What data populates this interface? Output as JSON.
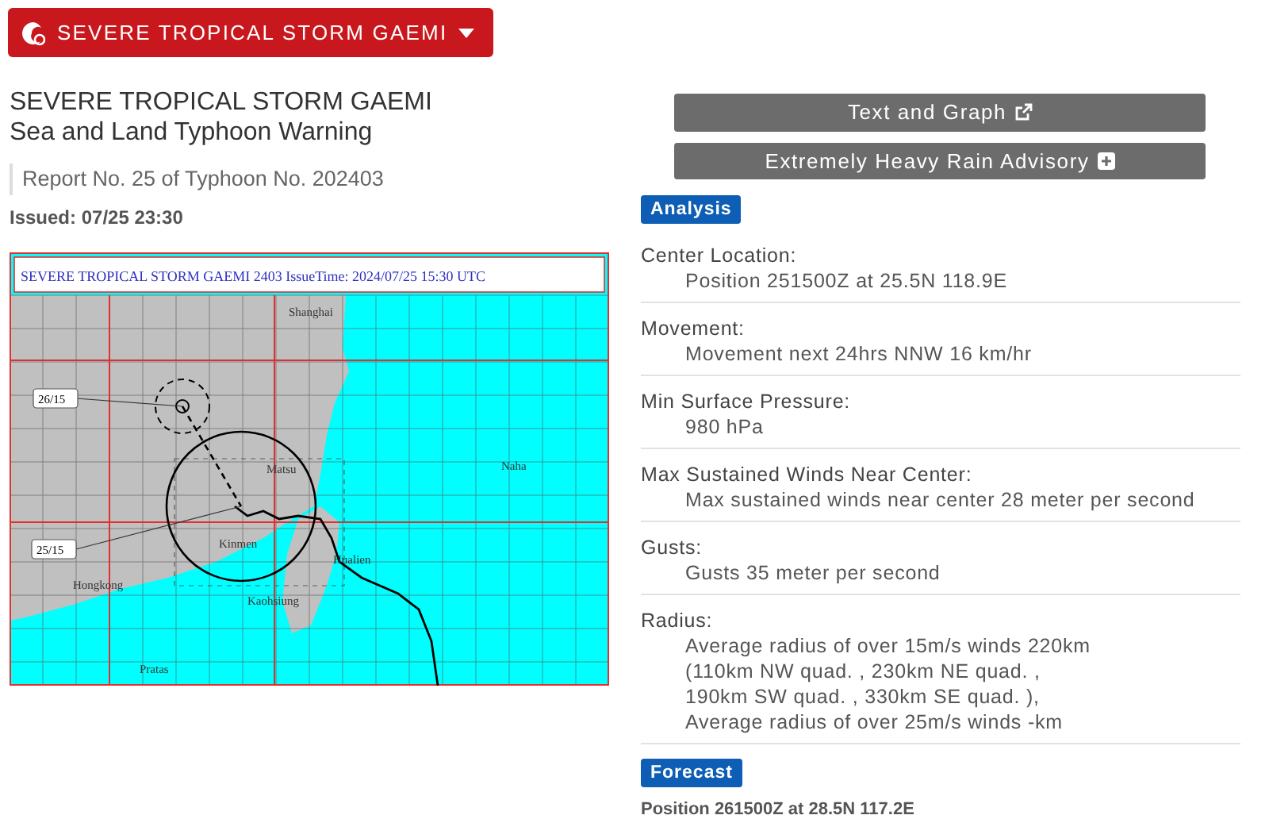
{
  "storm_menu": {
    "label": "SEVERE TROPICAL STORM GAEMI"
  },
  "heading": {
    "title": "SEVERE TROPICAL STORM GAEMI",
    "subtitle": "Sea and Land Typhoon Warning"
  },
  "report": "Report No. 25 of Typhoon No. 202403",
  "issued": "Issued: 07/25 23:30",
  "map": {
    "title": "SEVERE TROPICAL STORM GAEMI 2403 IssueTime: 2024/07/25 15:30 UTC",
    "track_labels": [
      "26/15",
      "25/15"
    ],
    "places": [
      "Shanghai",
      "Matsu",
      "Naha",
      "Kinmen",
      "Hualien",
      "Hongkong",
      "Kaohsiung",
      "Pratas"
    ]
  },
  "links": [
    {
      "label": "Text and Graph",
      "kind": "external"
    },
    {
      "label": "Extremely Heavy Rain Advisory",
      "kind": "expand"
    }
  ],
  "analysis": {
    "badge": "Analysis",
    "sections": [
      {
        "heading": "Center Location:",
        "lines": [
          "Position 251500Z at 25.5N 118.9E"
        ]
      },
      {
        "heading": "Movement:",
        "lines": [
          "Movement next 24hrs NNW 16 km/hr"
        ]
      },
      {
        "heading": "Min Surface Pressure:",
        "lines": [
          "980 hPa"
        ]
      },
      {
        "heading": "Max Sustained Winds Near Center:",
        "lines": [
          "Max sustained winds near center 28 meter per second"
        ]
      },
      {
        "heading": "Gusts:",
        "lines": [
          "Gusts 35 meter per second"
        ]
      },
      {
        "heading": "Radius:",
        "lines": [
          "Average radius of over 15m/s winds 220km",
          "(110km NW quad. , 230km NE quad. ,",
          "190km SW quad. , 330km SE quad. ),",
          "Average radius of over 25m/s winds -km"
        ]
      }
    ]
  },
  "forecast": {
    "badge": "Forecast",
    "lines": [
      "Position 261500Z at 28.5N 117.2E"
    ]
  }
}
